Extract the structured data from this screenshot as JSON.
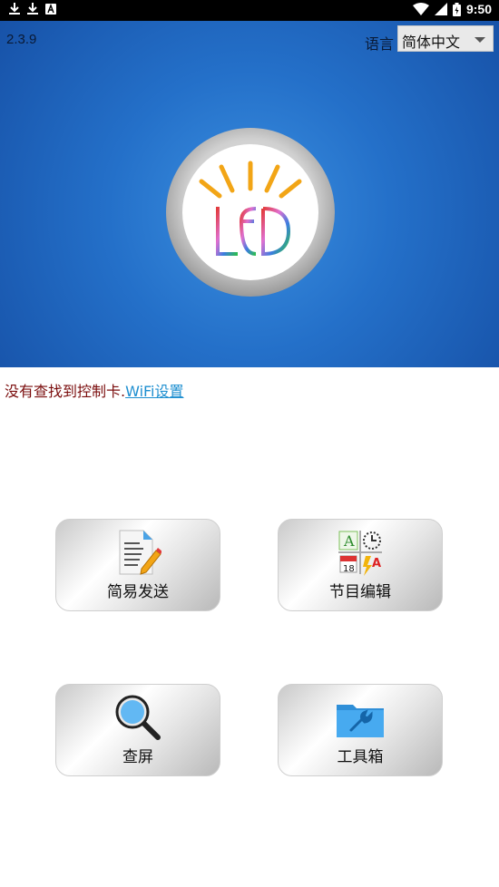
{
  "status_bar": {
    "time": "9:50",
    "left_icons": [
      "download-icon",
      "download-icon",
      "app-notification-icon"
    ],
    "right_icons": [
      "wifi-icon",
      "signal-icon",
      "battery-icon"
    ]
  },
  "header": {
    "version": "2.3.9",
    "language_label": "语言",
    "language_selected": "简体中文"
  },
  "message": {
    "text": "没有查找到控制卡.",
    "link": "WiFi设置"
  },
  "tiles": [
    {
      "label": "简易发送",
      "icon": "document-edit-icon"
    },
    {
      "label": "节目编辑",
      "icon": "program-grid-icon"
    },
    {
      "label": "查屏",
      "icon": "magnifier-icon"
    },
    {
      "label": "工具箱",
      "icon": "toolbox-folder-icon"
    }
  ],
  "colors": {
    "hero_blue": "#2470c9",
    "message_red": "#7a0c0c",
    "link_blue": "#1e8fd0"
  }
}
